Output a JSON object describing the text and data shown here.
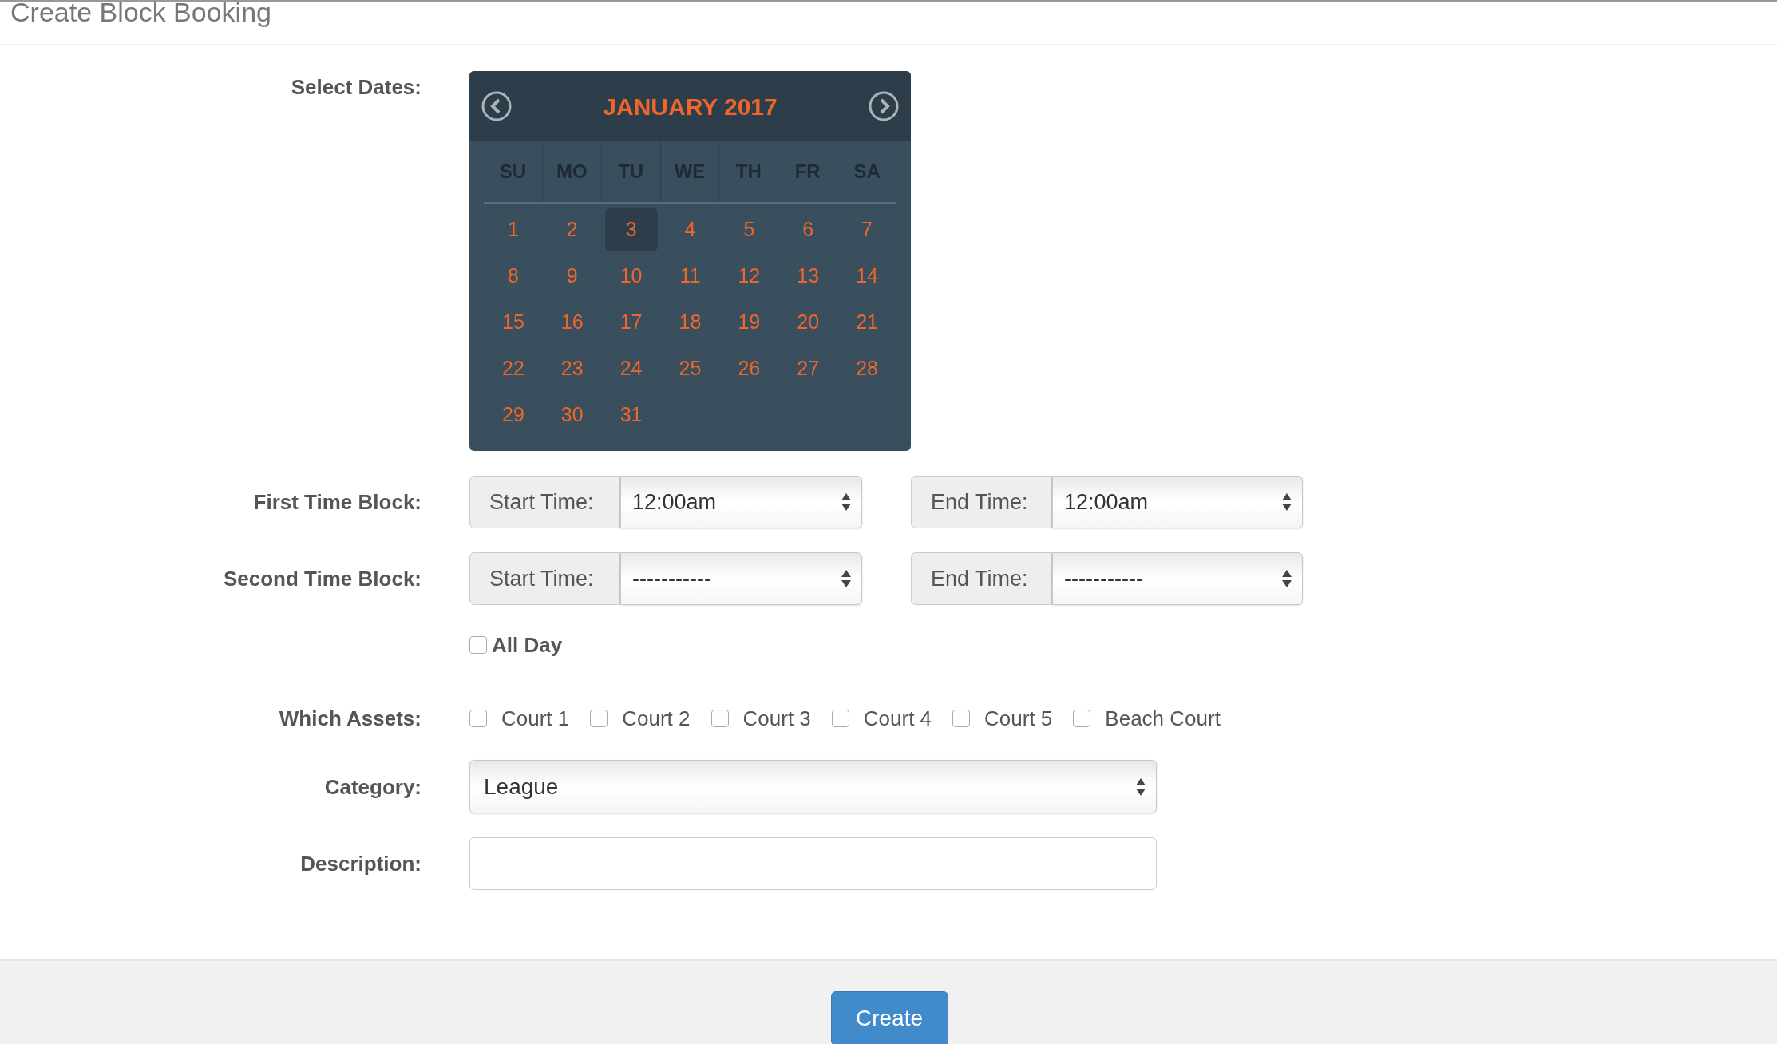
{
  "page_title": "Create Block Booking",
  "select_dates": {
    "label": "Select Dates:",
    "calendar": {
      "month": "JANUARY 2017",
      "weekdays": [
        "SU",
        "MO",
        "TU",
        "WE",
        "TH",
        "FR",
        "SA"
      ],
      "days": [
        {
          "label": "1",
          "selected": false
        },
        {
          "label": "2",
          "selected": false
        },
        {
          "label": "3",
          "selected": true
        },
        {
          "label": "4",
          "selected": false
        },
        {
          "label": "5",
          "selected": false
        },
        {
          "label": "6",
          "selected": false
        },
        {
          "label": "7",
          "selected": false
        },
        {
          "label": "8",
          "selected": false
        },
        {
          "label": "9",
          "selected": false
        },
        {
          "label": "10",
          "selected": false
        },
        {
          "label": "11",
          "selected": false
        },
        {
          "label": "12",
          "selected": false
        },
        {
          "label": "13",
          "selected": false
        },
        {
          "label": "14",
          "selected": false
        },
        {
          "label": "15",
          "selected": false
        },
        {
          "label": "16",
          "selected": false
        },
        {
          "label": "17",
          "selected": false
        },
        {
          "label": "18",
          "selected": false
        },
        {
          "label": "19",
          "selected": false
        },
        {
          "label": "20",
          "selected": false
        },
        {
          "label": "21",
          "selected": false
        },
        {
          "label": "22",
          "selected": false
        },
        {
          "label": "23",
          "selected": false
        },
        {
          "label": "24",
          "selected": false
        },
        {
          "label": "25",
          "selected": false
        },
        {
          "label": "26",
          "selected": false
        },
        {
          "label": "27",
          "selected": false
        },
        {
          "label": "28",
          "selected": false
        },
        {
          "label": "29",
          "selected": false
        },
        {
          "label": "30",
          "selected": false
        },
        {
          "label": "31",
          "selected": false
        }
      ]
    }
  },
  "time_blocks": [
    {
      "label": "First Time Block:",
      "start": {
        "addon": "Start Time:",
        "value": "12:00am"
      },
      "end": {
        "addon": "End Time:",
        "value": "12:00am"
      }
    },
    {
      "label": "Second Time Block:",
      "start": {
        "addon": "Start Time:",
        "value": "-----------"
      },
      "end": {
        "addon": "End Time:",
        "value": "-----------"
      }
    }
  ],
  "all_day": {
    "label": "All Day",
    "checked": false
  },
  "assets": {
    "label": "Which Assets:",
    "options": [
      {
        "label": "Court 1",
        "checked": false
      },
      {
        "label": "Court 2",
        "checked": false
      },
      {
        "label": "Court 3",
        "checked": false
      },
      {
        "label": "Court 4",
        "checked": false
      },
      {
        "label": "Court 5",
        "checked": false
      },
      {
        "label": "Beach Court",
        "checked": false
      }
    ]
  },
  "category": {
    "label": "Category:",
    "value": "League"
  },
  "description": {
    "label": "Description:"
  },
  "submit": "Create"
}
